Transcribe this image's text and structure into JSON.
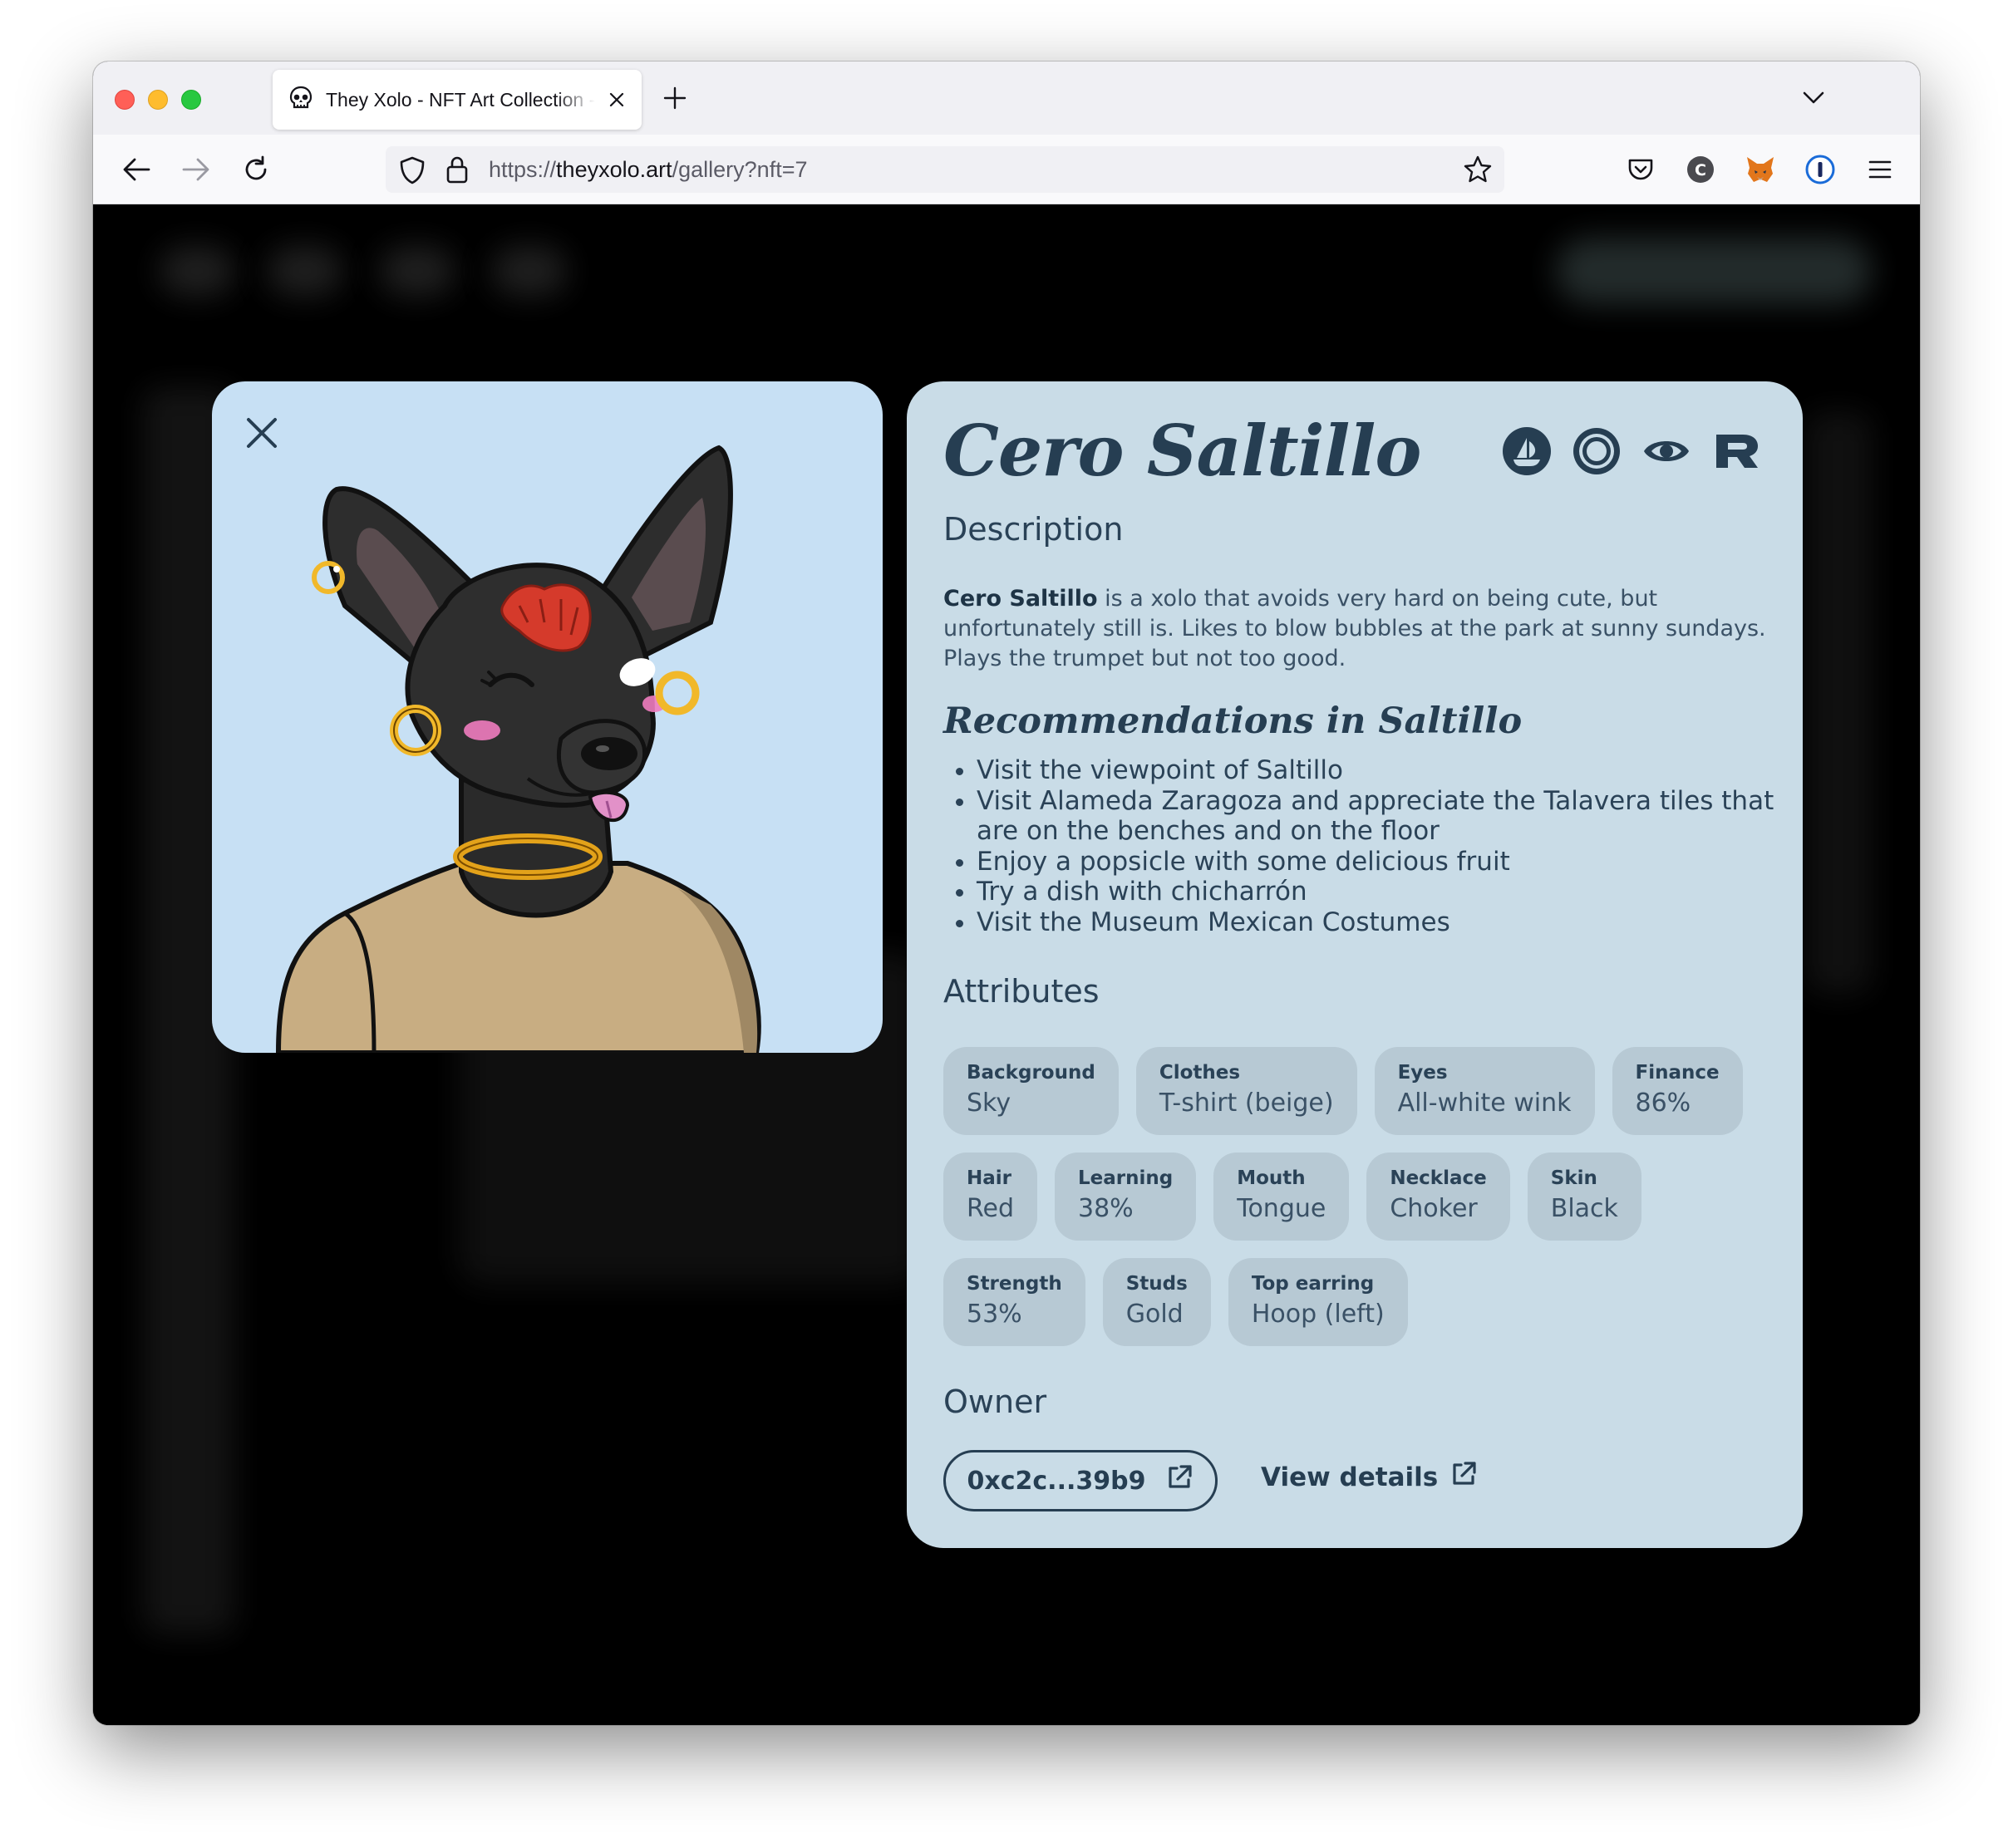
{
  "browser": {
    "tab_title": "They Xolo - NFT Art Collection - They Xolo",
    "url_scheme": "https://",
    "url_host": "theyxolo.art",
    "url_path": "/gallery?nft=7"
  },
  "nft": {
    "name": "Cero Saltillo",
    "description_heading": "Description",
    "description_name": "Cero Saltillo",
    "description_text": " is a xolo that avoids very hard on being cute, but unfortunately still is. Likes to blow bubbles at the park at sunny sundays. Plays the trumpet but not too good.",
    "recommendations_heading": "Recommendations in Saltillo",
    "recommendations": [
      "Visit the viewpoint of Saltillo",
      "Visit Alameda Zaragoza and appreciate the Talavera tiles that are on the benches and on the floor",
      "Enjoy a popsicle with some delicious fruit",
      "Try a dish with chicharrón",
      "Visit the Museum Mexican Costumes"
    ],
    "attributes_heading": "Attributes",
    "attributes": [
      {
        "key": "Background",
        "value": "Sky"
      },
      {
        "key": "Clothes",
        "value": "T-shirt (beige)"
      },
      {
        "key": "Eyes",
        "value": "All-white wink"
      },
      {
        "key": "Finance",
        "value": "86%"
      },
      {
        "key": "Hair",
        "value": "Red"
      },
      {
        "key": "Learning",
        "value": "38%"
      },
      {
        "key": "Mouth",
        "value": "Tongue"
      },
      {
        "key": "Necklace",
        "value": "Choker"
      },
      {
        "key": "Skin",
        "value": "Black"
      },
      {
        "key": "Strength",
        "value": "53%"
      },
      {
        "key": "Studs",
        "value": "Gold"
      },
      {
        "key": "Top earring",
        "value": "Hoop (left)"
      }
    ],
    "owner_heading": "Owner",
    "owner_address": "0xc2c...39b9",
    "view_details_label": "View details"
  },
  "colors": {
    "card_bg": "#c9dce7",
    "art_bg": "#c7e0f4",
    "text_dark": "#263e52",
    "chip_bg": "#b7c9d4"
  }
}
